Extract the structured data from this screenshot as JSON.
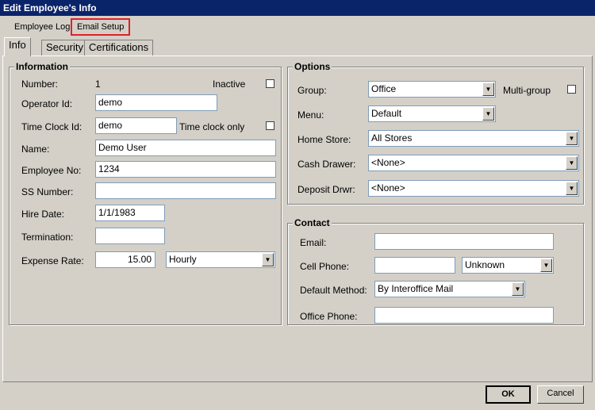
{
  "window": {
    "title": "Edit Employee's Info"
  },
  "toolbar": {
    "employee_log": "Employee Log",
    "email_setup": "Email Setup"
  },
  "tabs": [
    "Info",
    "Security",
    "Certifications"
  ],
  "information": {
    "title": "Information",
    "number_label": "Number:",
    "number_value": "1",
    "inactive_label": "Inactive",
    "operator_id_label": "Operator Id:",
    "operator_id": "demo",
    "time_clock_id_label": "Time Clock Id:",
    "time_clock_id": "demo",
    "time_clock_only_label": "Time clock only",
    "name_label": "Name:",
    "name": "Demo User",
    "employee_no_label": "Employee No:",
    "employee_no": "1234",
    "ss_number_label": "SS Number:",
    "ss_number": "",
    "hire_date_label": "Hire Date:",
    "hire_date": "1/1/1983",
    "termination_label": "Termination:",
    "termination": "",
    "expense_rate_label": "Expense Rate:",
    "expense_rate": "15.00",
    "expense_rate_unit": "Hourly"
  },
  "options": {
    "title": "Options",
    "group_label": "Group:",
    "group": "Office",
    "multi_group_label": "Multi-group",
    "menu_label": "Menu:",
    "menu": "Default",
    "home_store_label": "Home Store:",
    "home_store": "All Stores",
    "cash_drawer_label": "Cash Drawer:",
    "cash_drawer": "<None>",
    "deposit_drwr_label": "Deposit Drwr:",
    "deposit_drwr": "<None>"
  },
  "contact": {
    "title": "Contact",
    "email_label": "Email:",
    "email": "",
    "cell_phone_label": "Cell Phone:",
    "cell_phone": "",
    "carrier": "Unknown",
    "default_method_label": "Default Method:",
    "default_method": "By Interoffice Mail",
    "office_phone_label": "Office Phone:",
    "office_phone": ""
  },
  "buttons": {
    "ok": "OK",
    "cancel": "Cancel"
  }
}
